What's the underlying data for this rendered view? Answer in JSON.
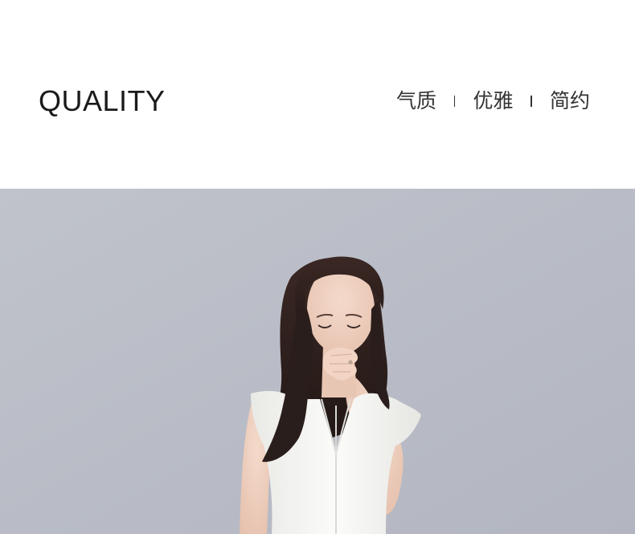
{
  "header": {
    "title": "QUALITY",
    "tags": [
      {
        "label": "气质"
      },
      {
        "label": "优雅"
      },
      {
        "label": "简约"
      }
    ]
  },
  "photo": {
    "subject": "model-photo",
    "colors": {
      "background": "#b9bcc6",
      "hair": "#2a1e1c",
      "skin": "#f0d2c2",
      "top": "#f7f7f5"
    }
  }
}
